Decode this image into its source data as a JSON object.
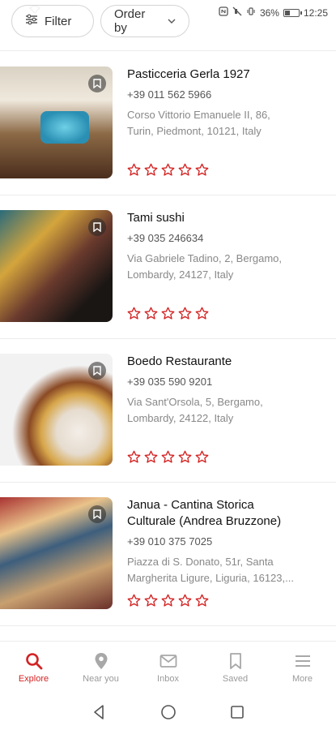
{
  "status_bar": {
    "battery_percent": "36%",
    "time": "12:25",
    "battery_level": 0.36
  },
  "chips": {
    "filter_label": "Filter",
    "order_label": "Order by"
  },
  "accent_color": "#d32323",
  "places": [
    {
      "name": "Pasticceria Gerla 1927",
      "phone": "+39 011 562 5966",
      "address_line1": "Corso Vittorio Emanuele II,  86,",
      "address_line2": "Turin, Piedmont, 10121, Italy",
      "rating_stars": 0
    },
    {
      "name": "Tami sushi",
      "phone": "+39 035 246634",
      "address_line1": "Via Gabriele Tadino,  2, Bergamo,",
      "address_line2": "Lombardy, 24127, Italy",
      "rating_stars": 0
    },
    {
      "name": "Boedo Restaurante",
      "phone": "+39 035 590 9201",
      "address_line1": "Via Sant'Orsola,  5, Bergamo,",
      "address_line2": "Lombardy, 24122, Italy",
      "rating_stars": 0
    },
    {
      "name_line1": "Janua - Cantina Storica",
      "name_line2": "Culturale (Andrea Bruzzone)",
      "phone": "+39 010 375 7025",
      "address_line1": "Piazza di S. Donato,  51r, Santa",
      "address_line2": "Margherita Ligure, Liguria, 16123,...",
      "rating_stars": 0
    }
  ],
  "nav": {
    "explore": "Explore",
    "near_you": "Near you",
    "inbox": "Inbox",
    "saved": "Saved",
    "more": "More"
  }
}
